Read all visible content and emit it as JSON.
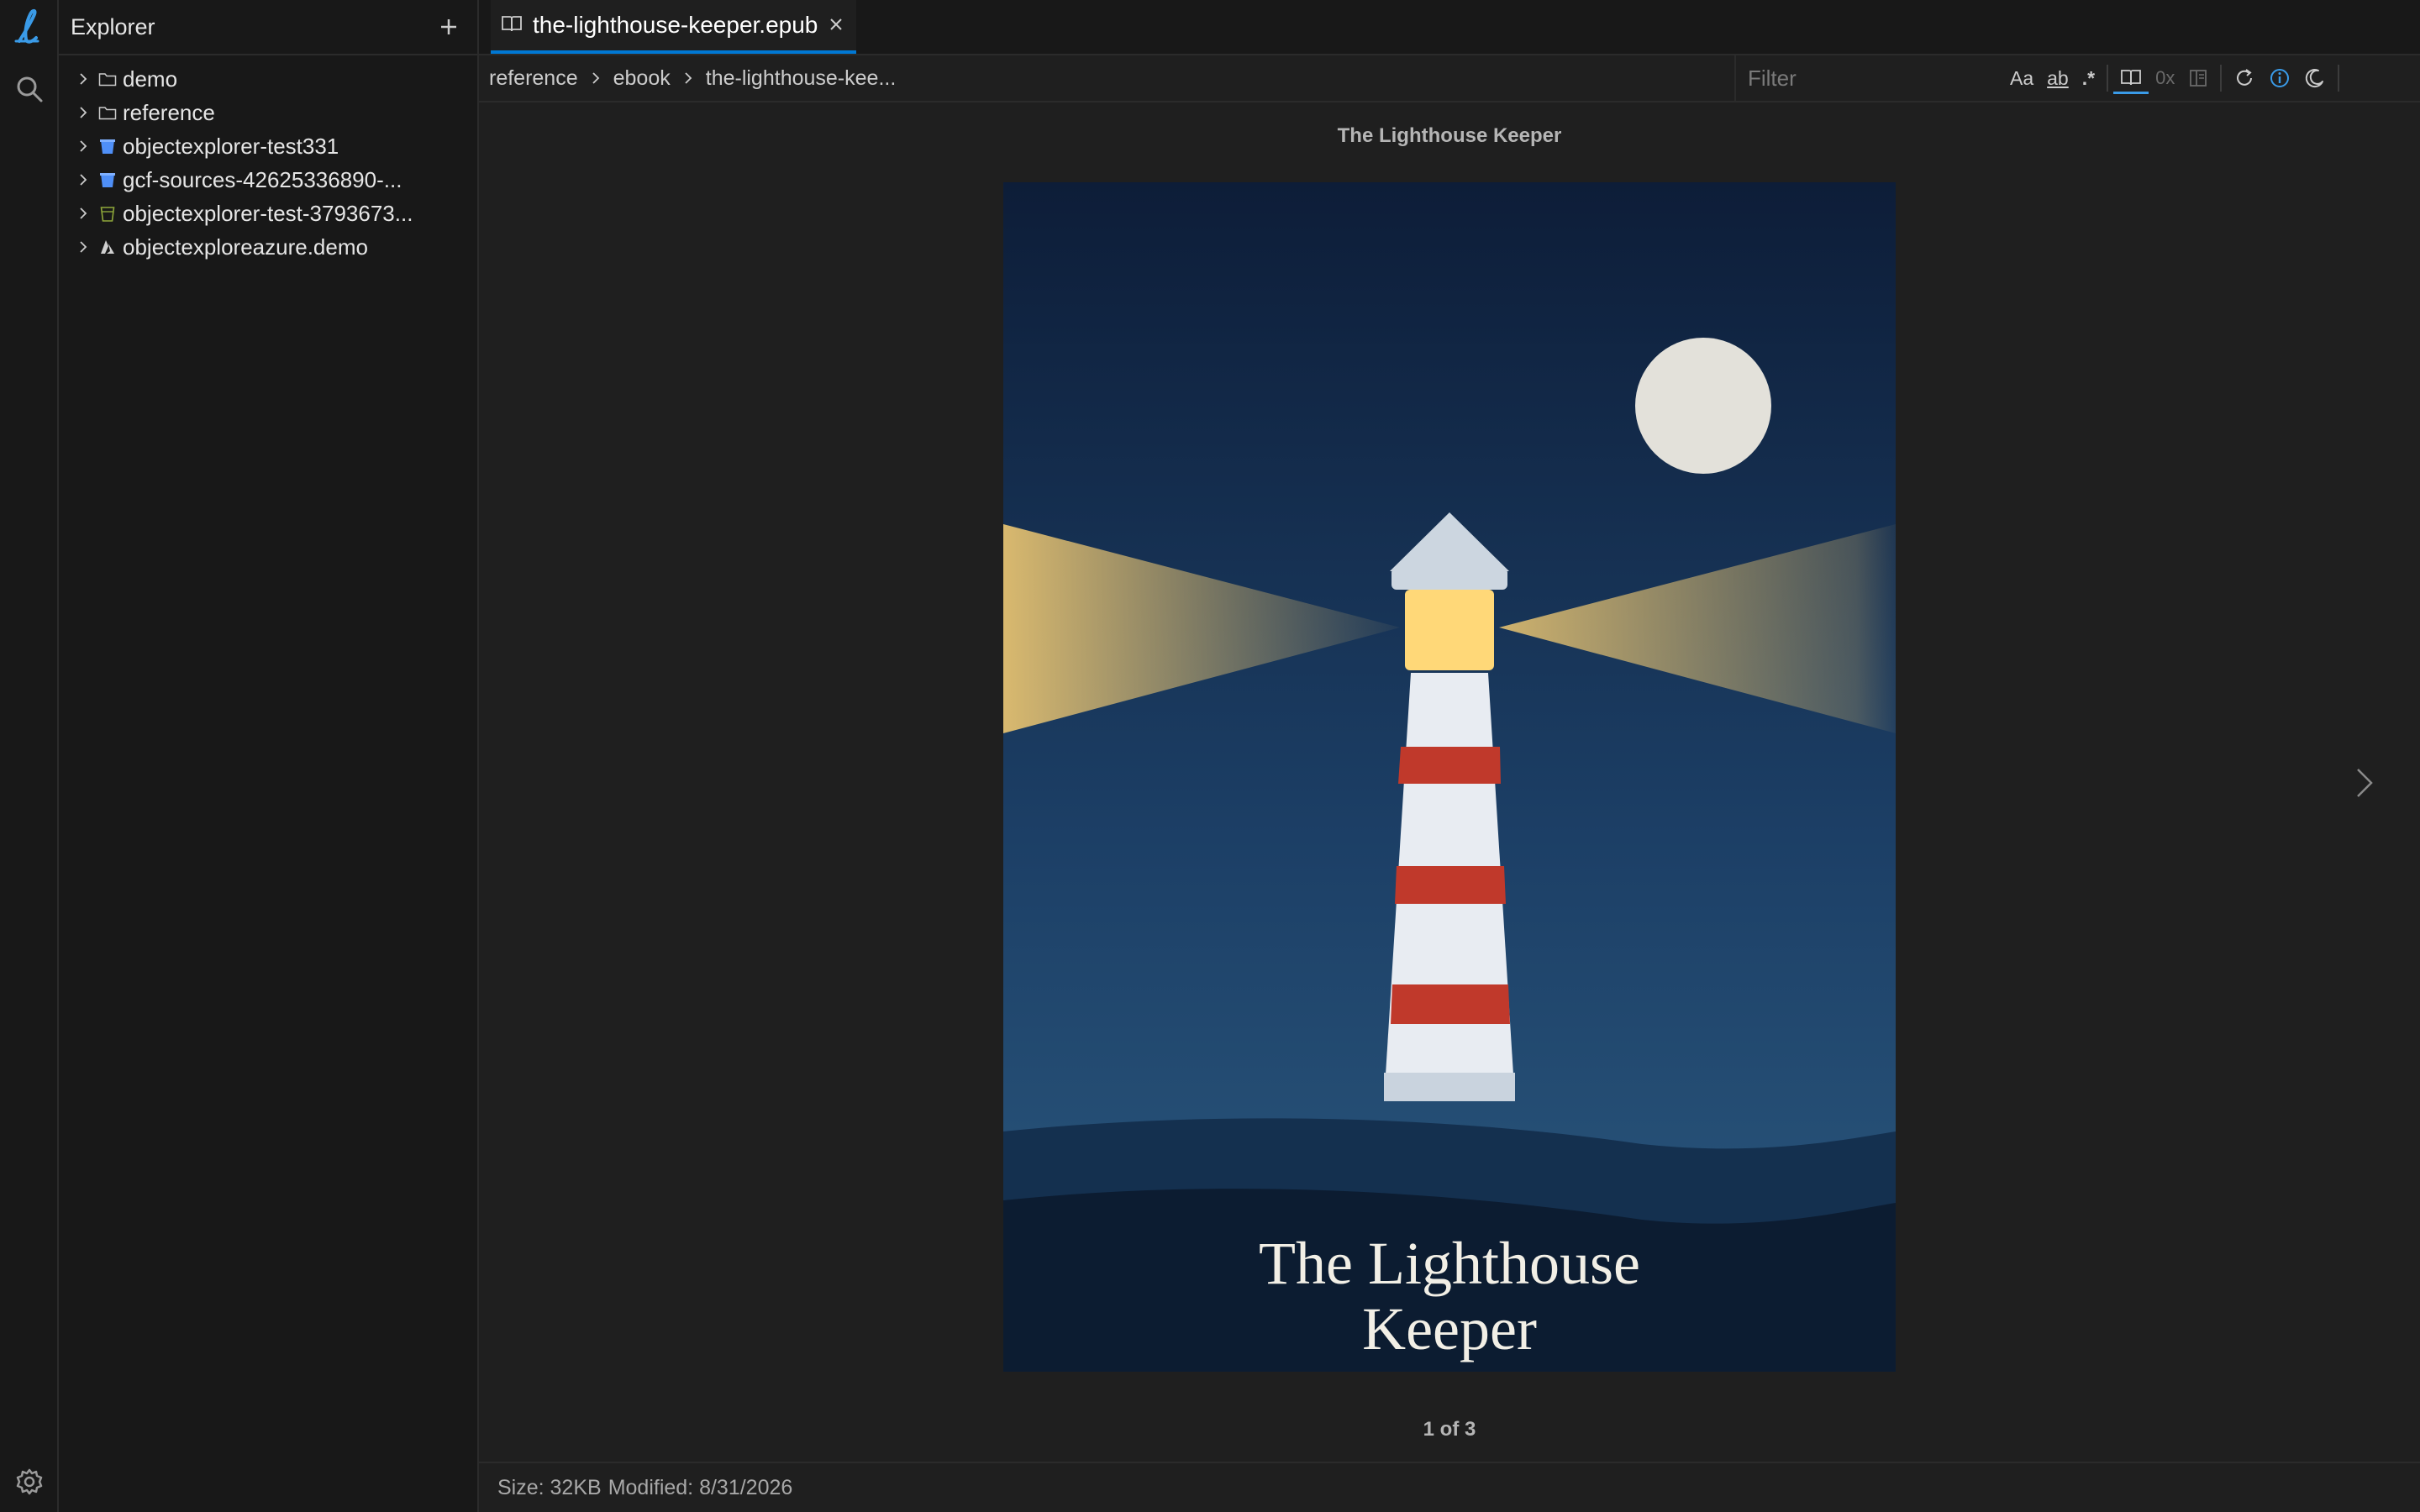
{
  "activity_bar": {
    "logo_icon": "app-logo-icon",
    "search_icon": "search-icon",
    "settings_icon": "gear-icon"
  },
  "sidebar": {
    "title": "Explorer",
    "add_icon": "plus-icon",
    "items": [
      {
        "label": "demo",
        "icon": "folder-icon"
      },
      {
        "label": "reference",
        "icon": "folder-icon"
      },
      {
        "label": "objectexplorer-test331",
        "icon": "bucket-icon-blue"
      },
      {
        "label": "gcf-sources-42625336890-...",
        "icon": "bucket-icon-blue"
      },
      {
        "label": "objectexplorer-test-3793673...",
        "icon": "bucket-icon-green"
      },
      {
        "label": "objectexploreazure.demo",
        "icon": "azure-icon"
      }
    ]
  },
  "tabs": [
    {
      "label": "the-lighthouse-keeper.epub",
      "icon": "book-icon",
      "active": true
    }
  ],
  "breadcrumb": [
    "reference",
    "ebook",
    "the-lighthouse-kee..."
  ],
  "filter": {
    "placeholder": "Filter",
    "value": ""
  },
  "toolbar": {
    "match_case": "Aa",
    "match_word": "ab",
    "regex": ".*",
    "count": "0x"
  },
  "viewer": {
    "book_title": "The Lighthouse Keeper",
    "cover_title_line1": "The Lighthouse",
    "cover_title_line2": "Keeper",
    "page_indicator": "1 of 3"
  },
  "status": {
    "size": "Size: 32KB",
    "modified": "Modified: 8/31/2026"
  },
  "colors": {
    "accent": "#0078d4",
    "sky_top": "#0e1f3a",
    "sky_bottom": "#2a5478",
    "beam": "#e8c26c",
    "lamp": "#ffd878",
    "stripe": "#c0392b",
    "moon": "#e3e1da"
  }
}
